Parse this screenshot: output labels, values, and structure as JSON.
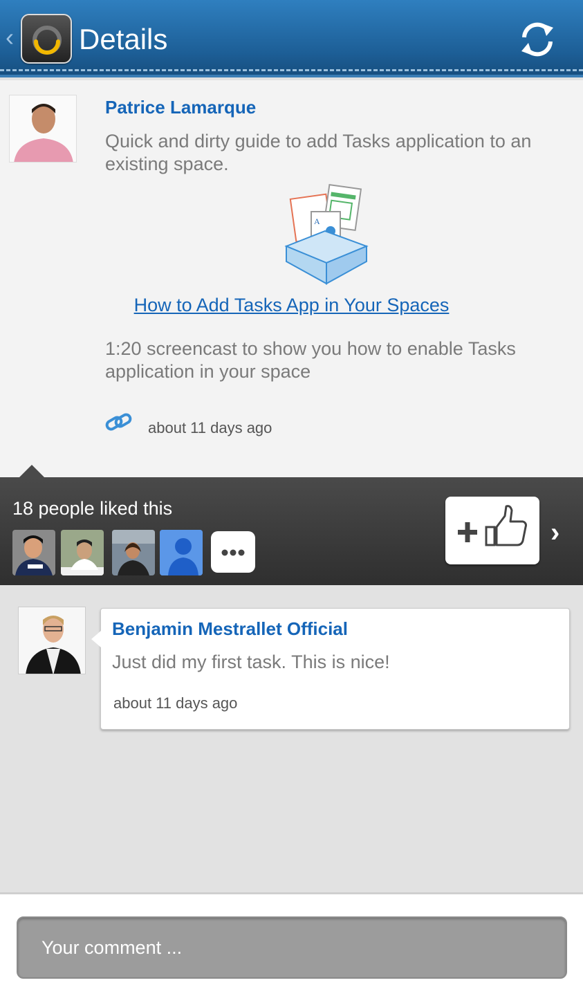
{
  "header": {
    "title": "Details",
    "back_icon": "chevron-left-icon",
    "logo_icon": "app-logo-icon",
    "refresh_icon": "refresh-icon"
  },
  "post": {
    "author": "Patrice Lamarque",
    "text": "Quick and dirty guide to add Tasks application to an existing space.",
    "link_title": "How to Add Tasks App in Your Spaces",
    "link_description": "1:20 screencast to show you how to enable Tasks application in your space",
    "timestamp": "about 11 days ago",
    "link_icon": "link-icon"
  },
  "likes": {
    "summary": "18 people liked this",
    "more_icon": "more-icon",
    "like_button_icon": "plus-thumbs-up-icon"
  },
  "comment": {
    "author": "Benjamin Mestrallet Official",
    "text": "Just did my first task. This is nice!",
    "timestamp": "about 11 days ago"
  },
  "composer": {
    "placeholder": "Your comment ..."
  },
  "colors": {
    "header_blue": "#1d5f97",
    "link_blue": "#1565b8",
    "logo_ring": "#f2b800"
  }
}
